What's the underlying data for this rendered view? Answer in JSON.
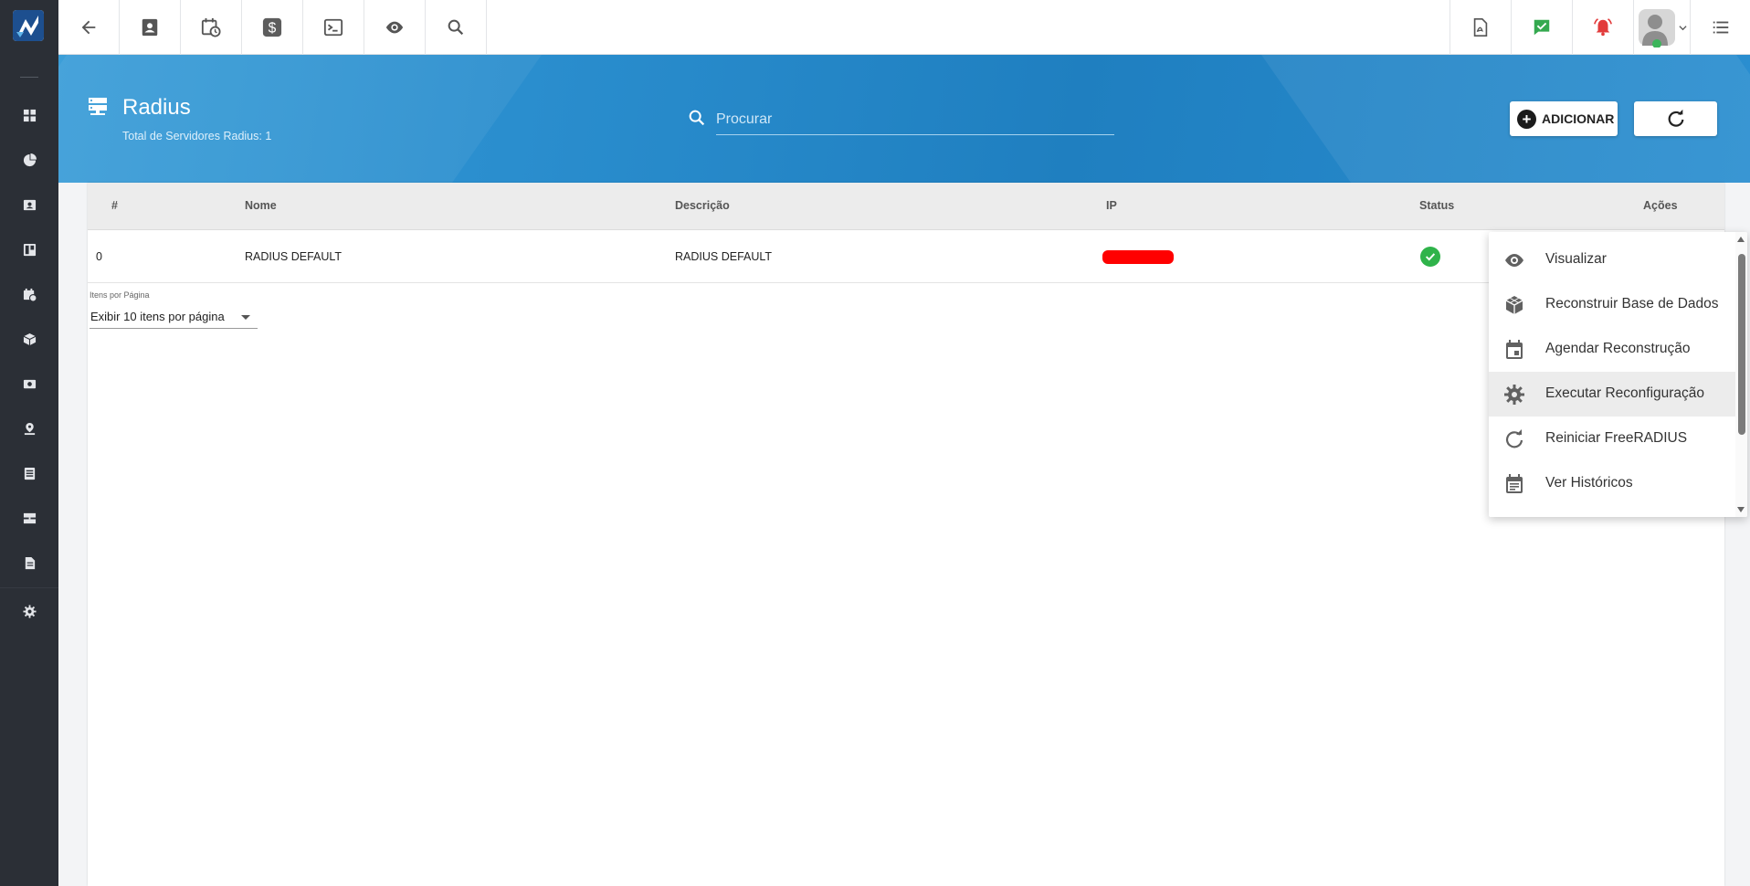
{
  "page": {
    "title": "Radius",
    "subtitle": "Total de Servidores Radius: 1"
  },
  "search": {
    "placeholder": "Procurar"
  },
  "actions": {
    "add_label": "ADICIONAR"
  },
  "colors": {
    "sidebar": "#2b2f36",
    "band": "#2b8fcf",
    "status_ok": "#2fb34a",
    "redaction": "#ff0000"
  },
  "topbar": {
    "left_icons": [
      "back-arrow-icon",
      "contact-card-icon",
      "calendar-clock-icon",
      "dollar-icon",
      "terminal-icon",
      "eye-icon",
      "search-icon"
    ],
    "right_icons": [
      "pdf-icon",
      "chat-check-icon",
      "alarm-bell-icon",
      "user-avatar",
      "menu-list-icon"
    ]
  },
  "sidebar": {
    "icons": [
      "dashboard-icon",
      "pie-chart-icon",
      "contact-icon",
      "board-icon",
      "calendar-icon",
      "box-icon",
      "money-icon",
      "location-icon",
      "list-icon",
      "server-icon",
      "document-icon",
      "settings-icon"
    ]
  },
  "table": {
    "headers": {
      "num": "#",
      "name": "Nome",
      "desc": "Descrição",
      "ip": "IP",
      "status": "Status",
      "actions": "Ações"
    },
    "rows": [
      {
        "num": "0",
        "name": "RADIUS DEFAULT",
        "desc": "RADIUS DEFAULT",
        "status": "ok"
      }
    ]
  },
  "pagination": {
    "label": "Itens por Página",
    "selected": "Exibir 10 itens por página"
  },
  "menu": {
    "items": [
      {
        "label": "Visualizar",
        "icon": "eye-icon"
      },
      {
        "label": "Reconstruir Base de Dados",
        "icon": "database-cube-icon"
      },
      {
        "label": "Agendar Reconstrução",
        "icon": "calendar-event-icon"
      },
      {
        "label": "Executar Reconfiguração",
        "icon": "gear-icon",
        "active": true
      },
      {
        "label": "Reiniciar FreeRADIUS",
        "icon": "refresh-icon"
      },
      {
        "label": "Ver Históricos",
        "icon": "history-list-icon"
      }
    ]
  }
}
